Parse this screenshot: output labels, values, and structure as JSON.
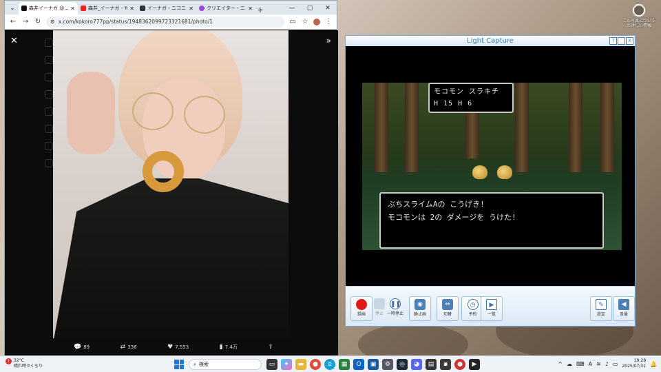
{
  "desktop": {
    "corner_label": "この写真についての詳しい情報"
  },
  "browser": {
    "tabs": [
      {
        "title": "森井イーナガ @...",
        "color": "#111111",
        "active": true
      },
      {
        "title": "森井_イーナガ - YouTube",
        "color": "#e22222",
        "active": false
      },
      {
        "title": "イーナガ - ニコニコ",
        "color": "#333333",
        "active": false
      },
      {
        "title": "クリエイター - ニコニコ",
        "color": "#9a4bd1",
        "active": false
      }
    ],
    "url": "x.com/kokoro777pp/status/1948362099723321681/photo/1",
    "actions": {
      "replies": "89",
      "reposts": "336",
      "likes": "7,553",
      "views": "7.4万"
    }
  },
  "light_capture": {
    "title": "Light Capture",
    "title_buttons": [
      "?",
      "_",
      "X"
    ],
    "game": {
      "status_line1": "モコモン スラキチ",
      "status_line2": "H 15 H  6",
      "message_line1": "ぶちスライムAの こうげき!",
      "message_line2": "モコモンは 2の ダメージを うけた!"
    },
    "toolbar": {
      "record": "録画",
      "stop": "停止",
      "pause": "一時停止",
      "still": "静止画",
      "switch": "切替",
      "schedule": "予約",
      "list": "一覧",
      "settings": "設定",
      "volume": "音量"
    }
  },
  "taskbar": {
    "weather_temp": "32°C",
    "weather_desc": "晴れ時々くもり",
    "search_placeholder": "検索",
    "time": "19:28",
    "date": "2025/07/31"
  }
}
